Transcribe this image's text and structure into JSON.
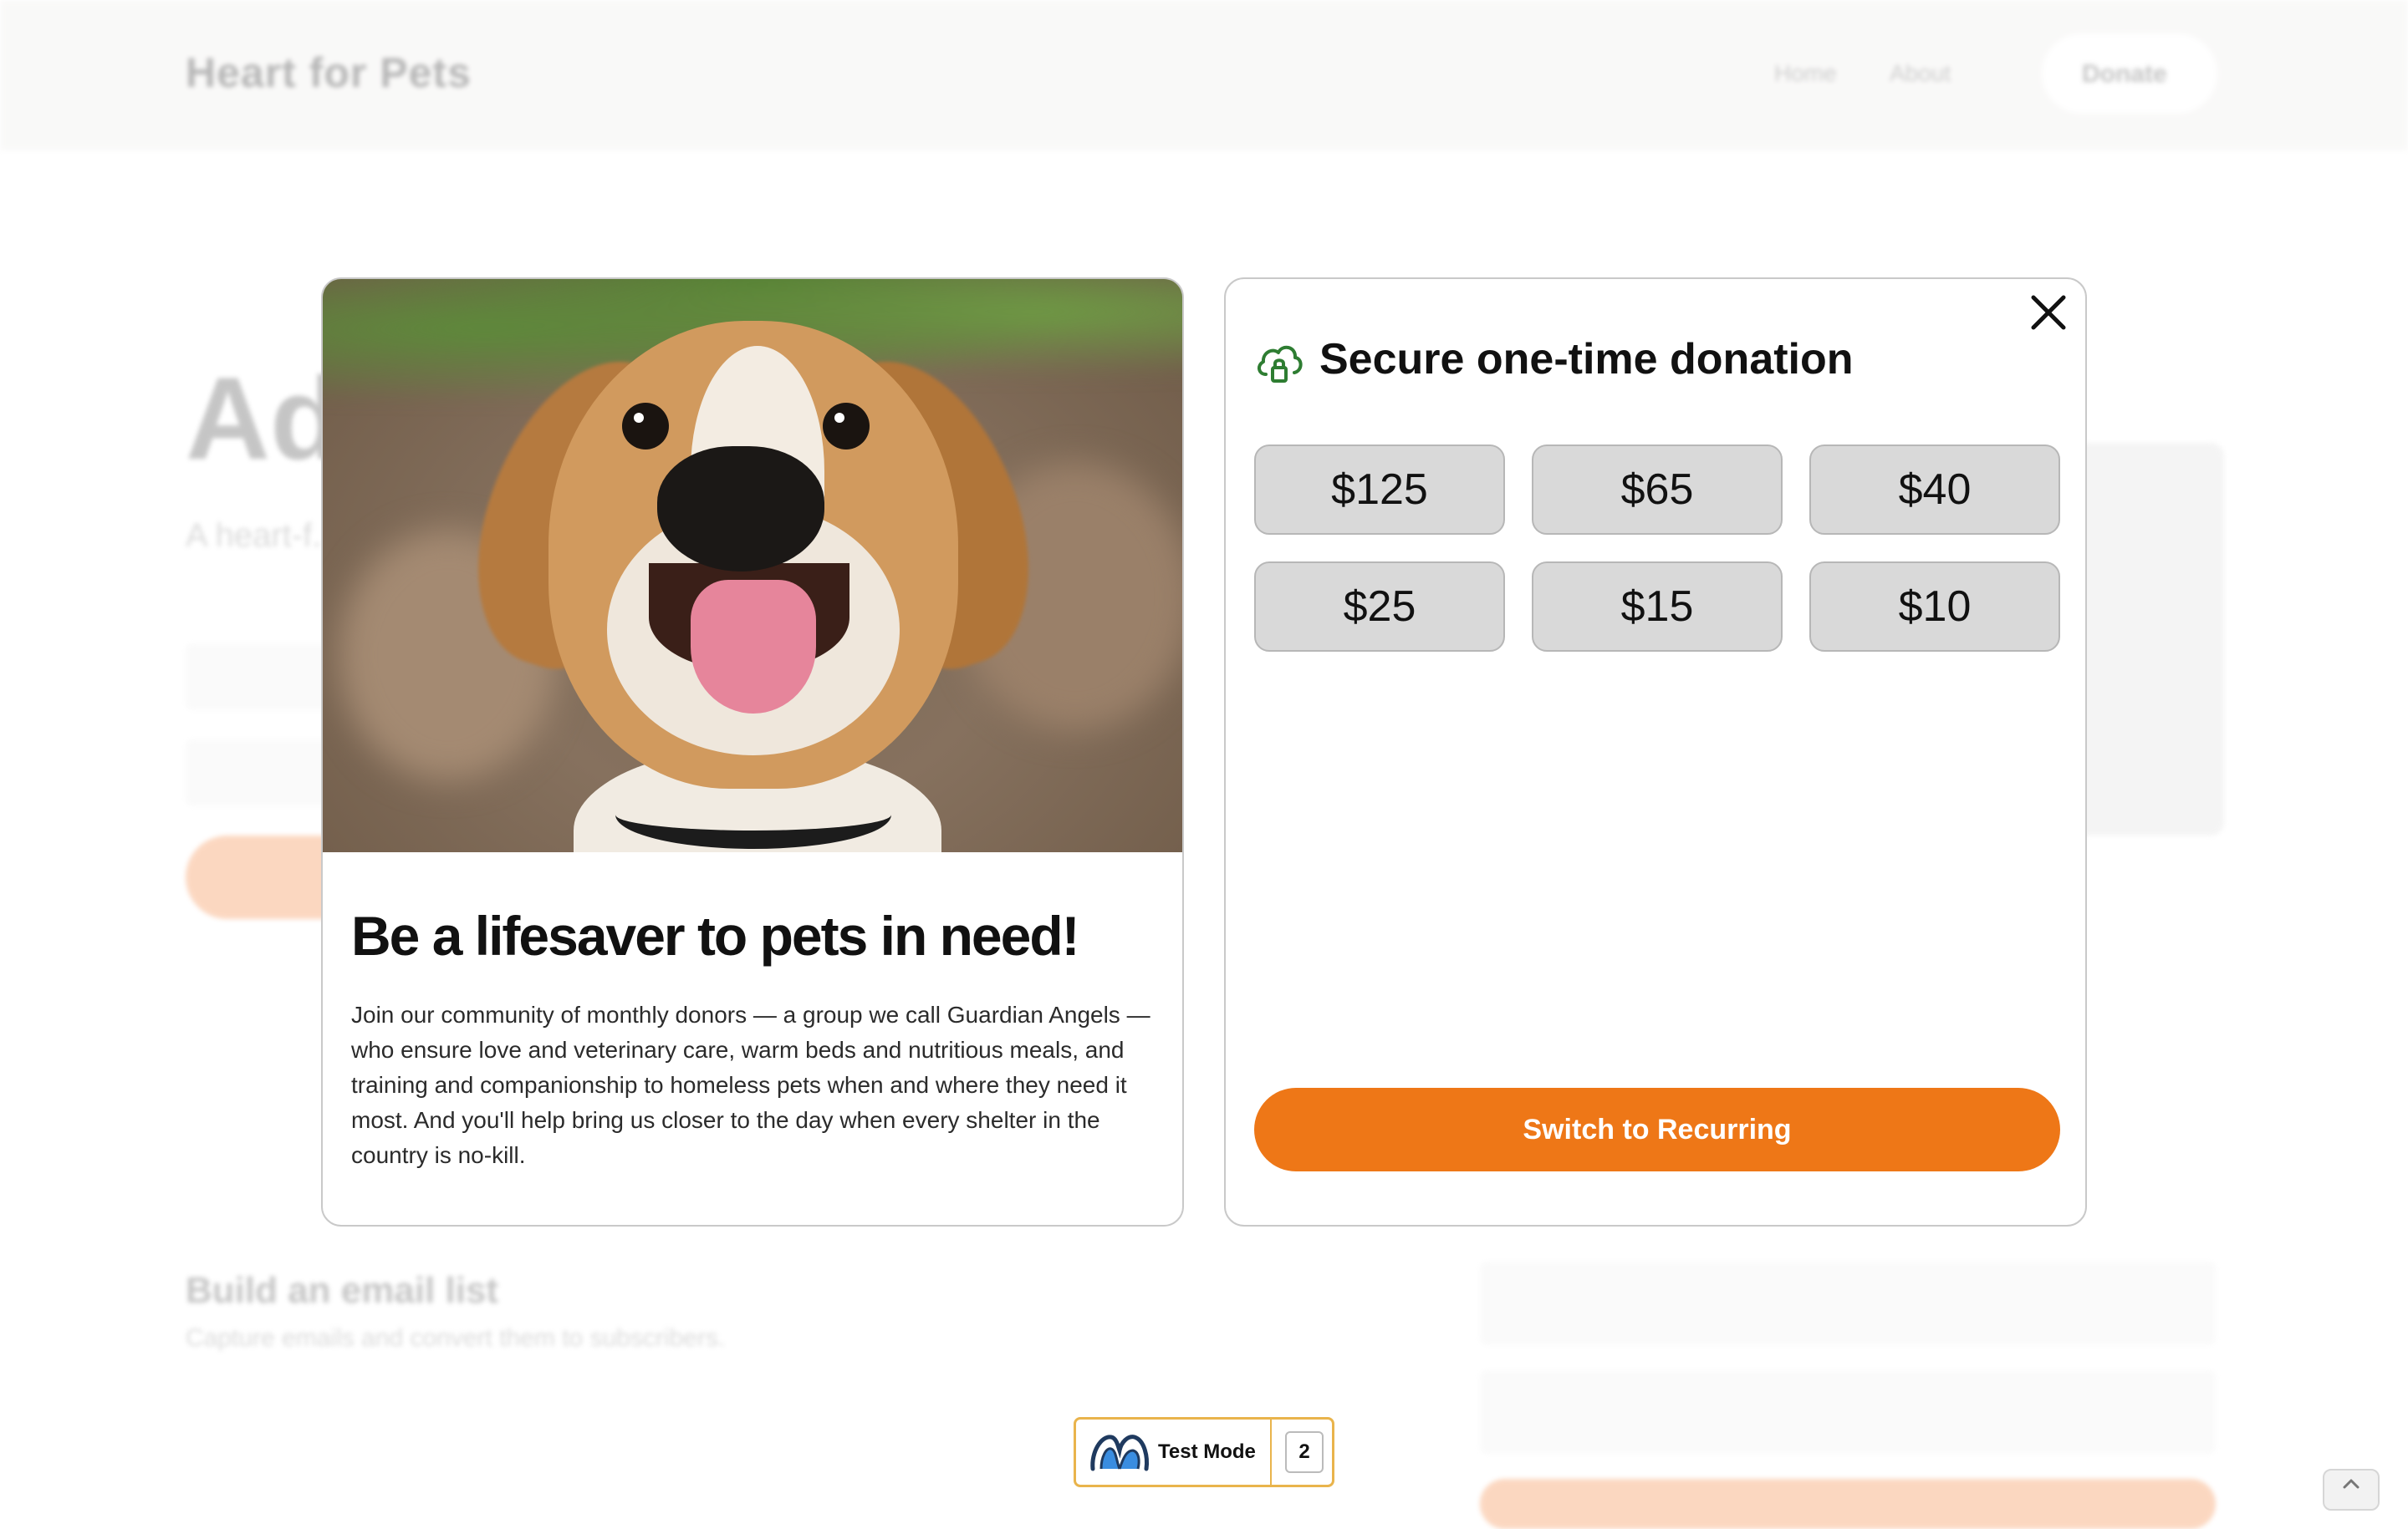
{
  "background_page": {
    "logo": "Heart for Pets",
    "nav": [
      "Home",
      "About"
    ],
    "donate_label": "Donate",
    "hero_title": "Ad",
    "hero_text": "A heart-f... pet l...",
    "email_title": "Build an email list",
    "email_subtitle": "Capture emails and convert them to subscribers."
  },
  "story_card": {
    "photo_alt": "beagle-dog-photo",
    "title": "Be a lifesaver to pets in need!",
    "body": "Join our community of monthly donors — a group we call Guardian Angels — who ensure love and veterinary care, warm beds and nutritious meals, and training and companionship to homeless pets when and where they need it most. And you'll help bring us closer to the day when every shelter in the country is no-kill."
  },
  "donation_card": {
    "title": "Secure one-time donation",
    "icon": "cloud-lock-icon",
    "amounts": [
      "$125",
      "$65",
      "$40",
      "$25",
      "$15",
      "$10"
    ],
    "recurring_label": "Switch to Recurring",
    "close_icon": "close-icon"
  },
  "test_mode": {
    "label": "Test Mode",
    "count": "2"
  },
  "colors": {
    "accent_orange": "#ee7717",
    "lock_green": "#2e7d32",
    "amount_bg": "#d9d9d9",
    "badge_border": "#e9b44c"
  }
}
